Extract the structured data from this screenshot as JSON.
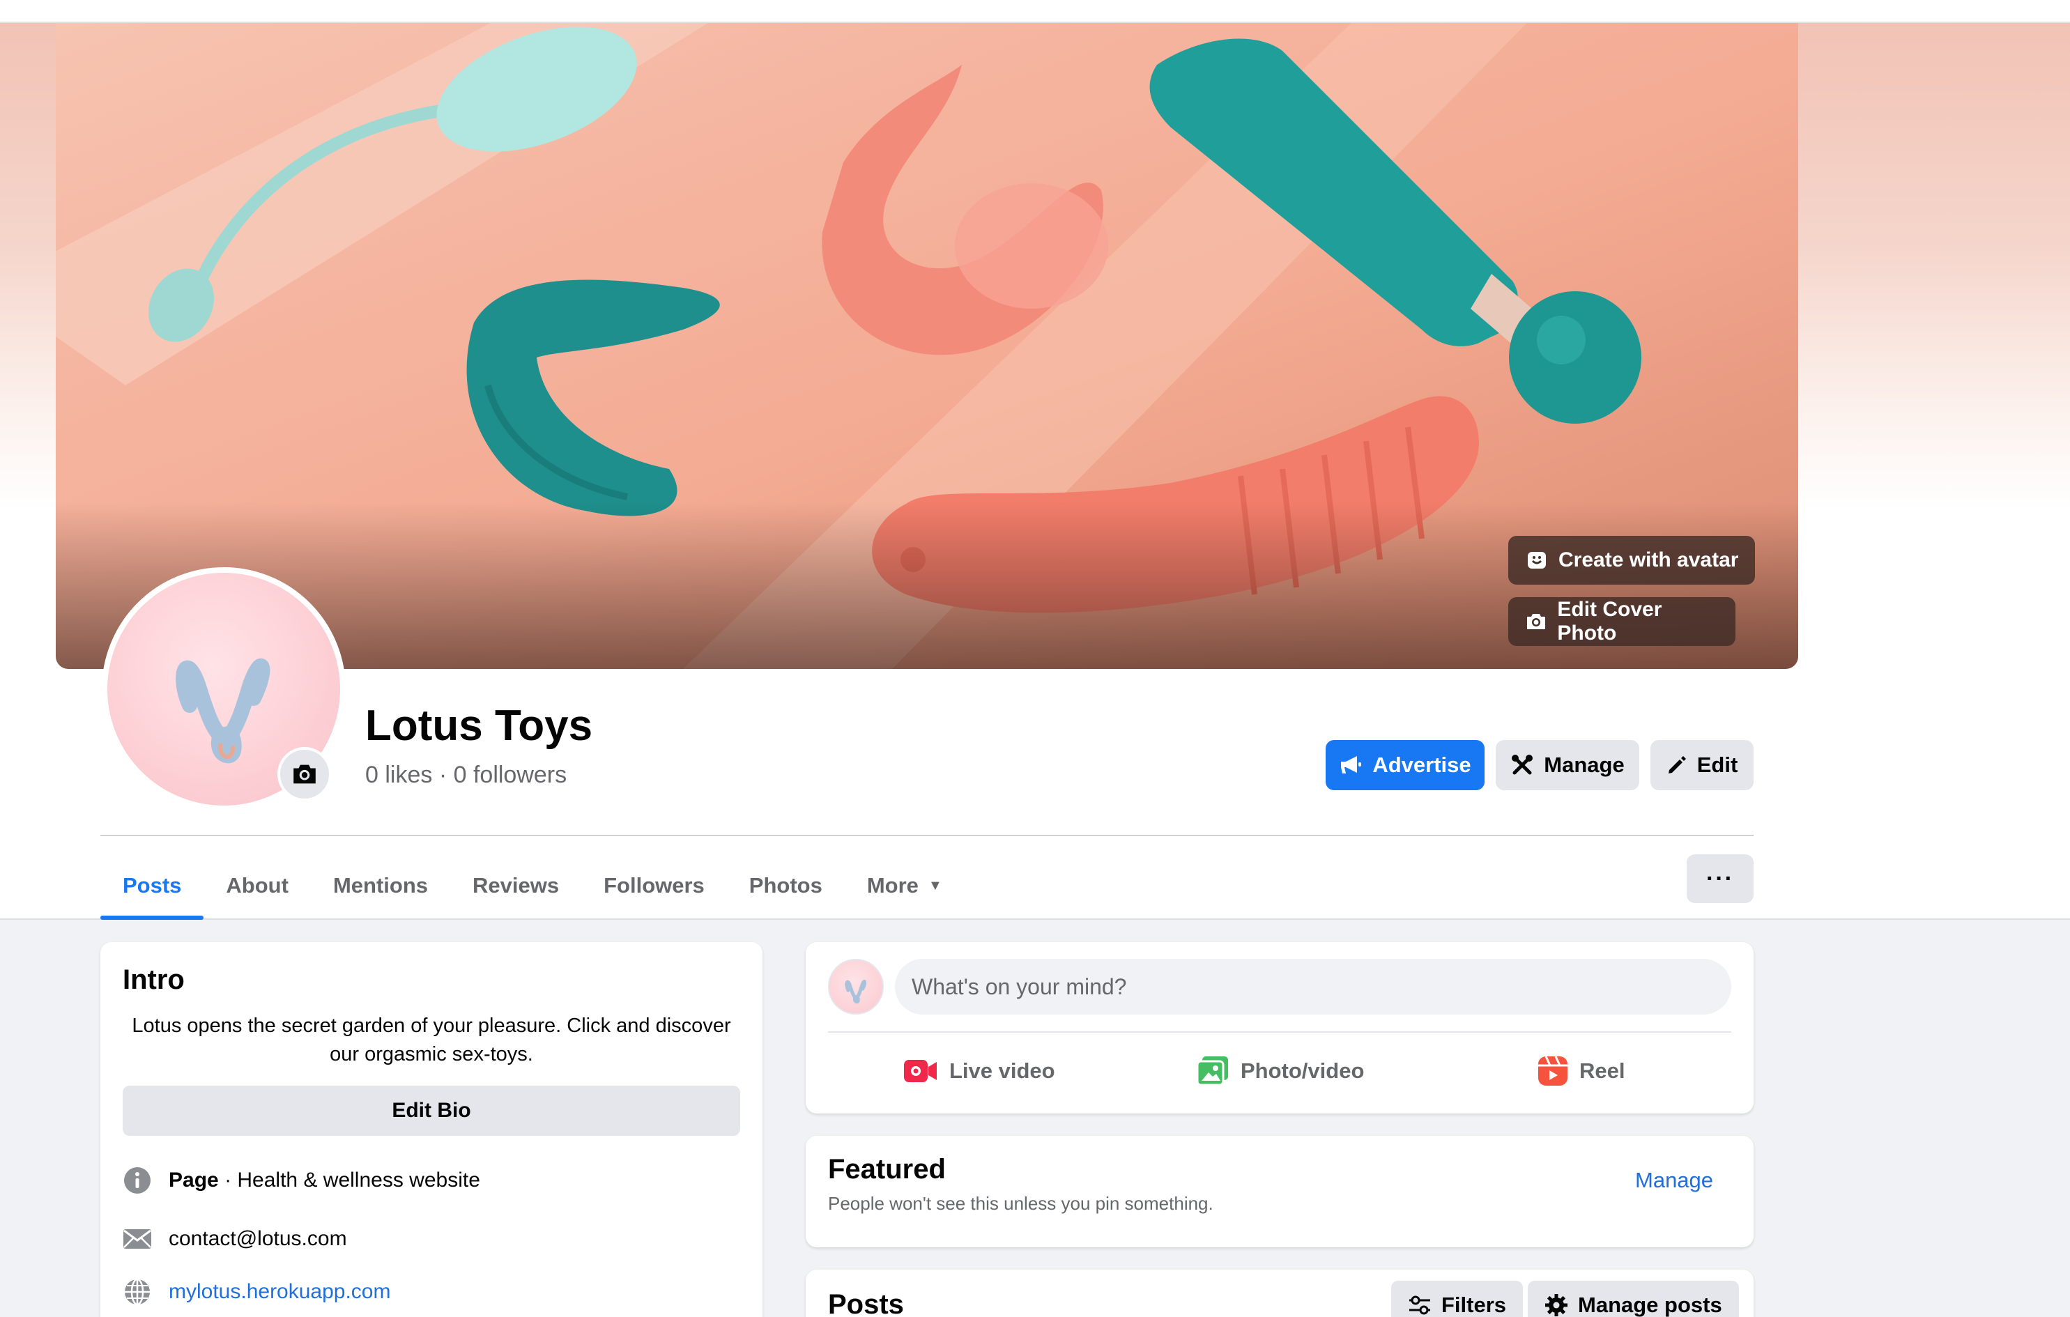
{
  "colors": {
    "accent": "#1877f2",
    "link": "#216fdb",
    "muted": "#65676b",
    "button_gray": "#e4e6eb"
  },
  "cover": {
    "create_avatar_label": "Create with avatar",
    "edit_cover_label": "Edit Cover Photo",
    "create_avatar_icon": "avatar-sticker-icon",
    "edit_cover_icon": "camera-icon"
  },
  "page": {
    "name": "Lotus Toys",
    "likes": "0 likes",
    "separator": "·",
    "followers": "0 followers"
  },
  "actions": {
    "advertise": "Advertise",
    "manage": "Manage",
    "edit": "Edit"
  },
  "tabs": [
    {
      "label": "Posts",
      "active": true
    },
    {
      "label": "About"
    },
    {
      "label": "Mentions"
    },
    {
      "label": "Reviews"
    },
    {
      "label": "Followers"
    },
    {
      "label": "Photos"
    },
    {
      "label": "More"
    }
  ],
  "more_menu_dots": "···",
  "intro": {
    "title": "Intro",
    "bio": "Lotus opens the secret garden of your pleasure. Click and discover our orgasmic sex-toys.",
    "edit_bio": "Edit Bio",
    "page_label": "Page",
    "category": "· Health & wellness website",
    "email": "contact@lotus.com",
    "website": "mylotus.herokuapp.com"
  },
  "composer": {
    "placeholder": "What's on your mind?",
    "live_video": "Live video",
    "photo_video": "Photo/video",
    "reel": "Reel"
  },
  "featured": {
    "title": "Featured",
    "subtitle": "People won't see this unless you pin something.",
    "manage": "Manage"
  },
  "posts": {
    "title": "Posts",
    "filters": "Filters",
    "manage_posts": "Manage posts"
  }
}
